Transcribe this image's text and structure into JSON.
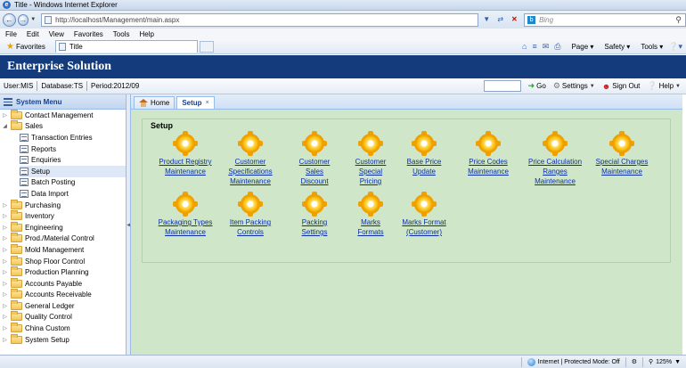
{
  "window": {
    "title": "Title - Windows Internet Explorer"
  },
  "browser": {
    "url": "http://localhost/Management/main.aspx",
    "search_placeholder": "Bing",
    "menu": [
      "File",
      "Edit",
      "View",
      "Favorites",
      "Tools",
      "Help"
    ],
    "favorites_label": "Favorites",
    "tab_title": "Title",
    "commands": {
      "page": "Page",
      "safety": "Safety",
      "tools": "Tools"
    }
  },
  "app": {
    "title": "Enterprise Solution",
    "user": "User:MIS",
    "database": "Database:TS",
    "period": "Period:2012/09",
    "go_label": "Go",
    "settings_label": "Settings",
    "signout_label": "Sign Out",
    "help_label": "Help"
  },
  "sidebar": {
    "title": "System Menu",
    "items": [
      {
        "label": "Contact Management",
        "type": "folder",
        "toggle": "+"
      },
      {
        "label": "Sales",
        "type": "folder",
        "toggle": "-"
      },
      {
        "label": "Transaction Entries",
        "type": "leaf"
      },
      {
        "label": "Reports",
        "type": "leaf"
      },
      {
        "label": "Enquiries",
        "type": "leaf"
      },
      {
        "label": "Setup",
        "type": "leaf",
        "selected": true
      },
      {
        "label": "Batch Posting",
        "type": "leaf"
      },
      {
        "label": "Data Import",
        "type": "leaf"
      },
      {
        "label": "Purchasing",
        "type": "folder",
        "toggle": "+"
      },
      {
        "label": "Inventory",
        "type": "folder",
        "toggle": "+"
      },
      {
        "label": "Engineering",
        "type": "folder",
        "toggle": "+"
      },
      {
        "label": "Prod./Material Control",
        "type": "folder",
        "toggle": "+"
      },
      {
        "label": "Mold Management",
        "type": "folder",
        "toggle": "+"
      },
      {
        "label": "Shop Floor Control",
        "type": "folder",
        "toggle": "+"
      },
      {
        "label": "Production Planning",
        "type": "folder",
        "toggle": "+"
      },
      {
        "label": "Accounts Payable",
        "type": "folder",
        "toggle": "+"
      },
      {
        "label": "Accounts Receivable",
        "type": "folder",
        "toggle": "+"
      },
      {
        "label": "General Ledger",
        "type": "folder",
        "toggle": "+"
      },
      {
        "label": "Quality Control",
        "type": "folder",
        "toggle": "+"
      },
      {
        "label": "China Custom",
        "type": "folder",
        "toggle": "+"
      },
      {
        "label": "System Setup",
        "type": "folder",
        "toggle": "+"
      }
    ]
  },
  "tabs": [
    {
      "label": "Home"
    },
    {
      "label": "Setup",
      "close": "×"
    }
  ],
  "setup": {
    "title": "Setup",
    "icon": "gear-icon",
    "row1": [
      [
        "Product Registry",
        "Maintenance"
      ],
      [
        "Customer",
        "Specifications",
        "Maintenance"
      ],
      [
        "Customer",
        "Sales",
        "Discount"
      ],
      [
        "Customer",
        "Special",
        "Pricing"
      ],
      [
        "Base Price",
        "Update"
      ],
      [
        "Price Codes",
        "Maintenance"
      ],
      [
        "Price Calculation",
        "Ranges",
        "Maintenance"
      ],
      [
        "Special Charges",
        "Maintenance"
      ]
    ],
    "row2": [
      [
        "Packaging Types",
        "Maintenance"
      ],
      [
        "Item Packing",
        "Controls"
      ],
      [
        "Packing",
        "Settings"
      ],
      [
        "Marks",
        "Formats"
      ],
      [
        "Marks Format",
        "(Customer)"
      ]
    ]
  },
  "status": {
    "zone": "Internet | Protected Mode: Off",
    "zoom": "125%"
  },
  "colors": {
    "banner": "#143b7c",
    "content_bg": "#cfe6c8",
    "link": "#0b2ea8"
  }
}
